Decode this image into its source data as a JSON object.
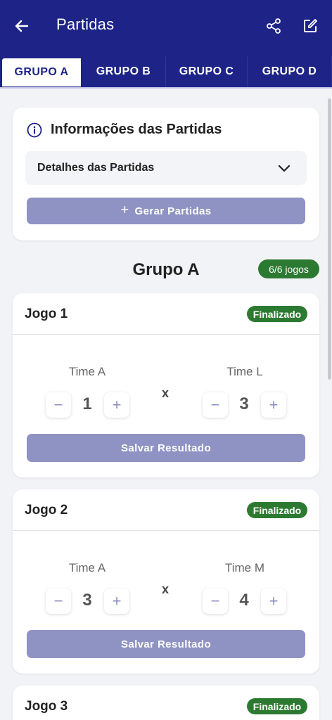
{
  "header": {
    "title": "Partidas"
  },
  "tabs": [
    {
      "label": "GRUPO A",
      "active": true
    },
    {
      "label": "GRUPO B",
      "active": false
    },
    {
      "label": "GRUPO C",
      "active": false
    },
    {
      "label": "GRUPO D",
      "active": false
    }
  ],
  "info": {
    "title": "Informações das Partidas",
    "dropdown_label": "Detalhes das Partidas",
    "generate_label": "Gerar Partidas"
  },
  "group": {
    "title": "Grupo A",
    "badge": "6/6 jogos"
  },
  "games": [
    {
      "title": "Jogo 1",
      "status": "Finalizado",
      "team_a": "Time A",
      "team_b": "Time L",
      "score_a": "1",
      "score_b": "3",
      "vs": "x",
      "save_label": "Salvar Resultado"
    },
    {
      "title": "Jogo 2",
      "status": "Finalizado",
      "team_a": "Time A",
      "team_b": "Time M",
      "score_a": "3",
      "score_b": "4",
      "vs": "x",
      "save_label": "Salvar Resultado"
    },
    {
      "title": "Jogo 3",
      "status": "Finalizado"
    }
  ],
  "symbols": {
    "minus": "−",
    "plus": "+"
  },
  "colors": {
    "primary": "#1e2388",
    "success": "#2c7a31",
    "button_muted": "#8f93c3",
    "background": "#f2f3f7"
  }
}
